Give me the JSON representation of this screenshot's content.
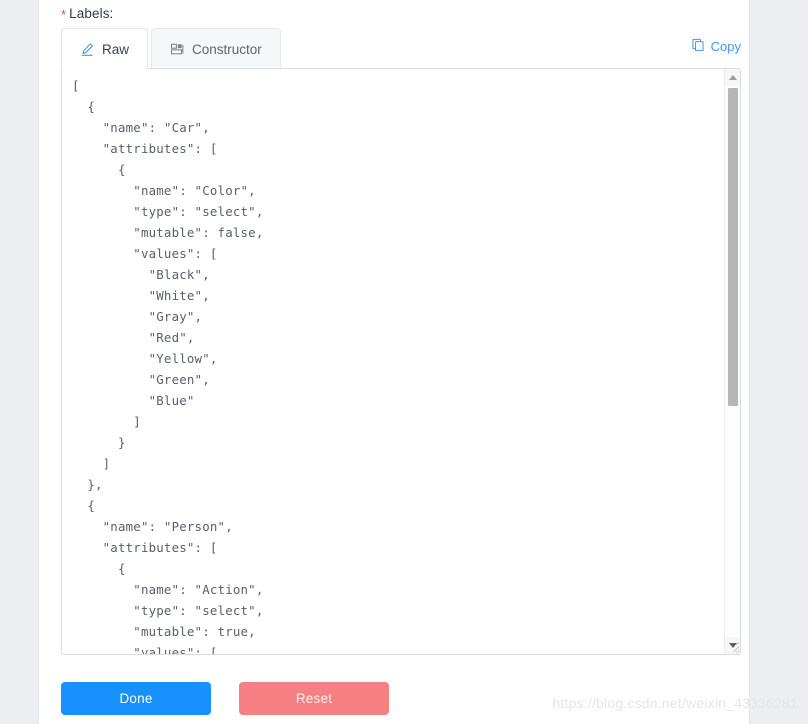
{
  "form": {
    "label": "Labels:",
    "required_marker": "*"
  },
  "tabs": [
    {
      "label": "Raw",
      "icon": "pencil-edit-icon",
      "active": true
    },
    {
      "label": "Constructor",
      "icon": "blocks-layout-icon",
      "active": false
    }
  ],
  "toolbar": {
    "copy_label": "Copy",
    "copy_icon": "copy-icon"
  },
  "editor": {
    "language": "json",
    "content": "[\n  {\n    \"name\": \"Car\",\n    \"attributes\": [\n      {\n        \"name\": \"Color\",\n        \"type\": \"select\",\n        \"mutable\": false,\n        \"values\": [\n          \"Black\",\n          \"White\",\n          \"Gray\",\n          \"Red\",\n          \"Yellow\",\n          \"Green\",\n          \"Blue\"\n        ]\n      }\n    ]\n  },\n  {\n    \"name\": \"Person\",\n    \"attributes\": [\n      {\n        \"name\": \"Action\",\n        \"type\": \"select\",\n        \"mutable\": true,\n        \"values\": [",
    "scrollbar": {
      "up_arrow": "scroll-up-arrow",
      "down_arrow": "scroll-down-arrow",
      "thumb_position_percent": 0,
      "thumb_size_percent": 57
    }
  },
  "buttons": {
    "done_label": "Done",
    "reset_label": "Reset"
  },
  "watermark": {
    "text": "https://blog.csdn.net/weixin_43336281"
  },
  "colors": {
    "accent_blue": "#1890ff",
    "link_blue": "#3f96e8",
    "reset_red": "#f57f82",
    "required_star": "#e8474c",
    "page_bg": "#eceef1",
    "card_bg": "#ffffff",
    "code_text": "#5a6068",
    "border": "#d9dce1"
  }
}
